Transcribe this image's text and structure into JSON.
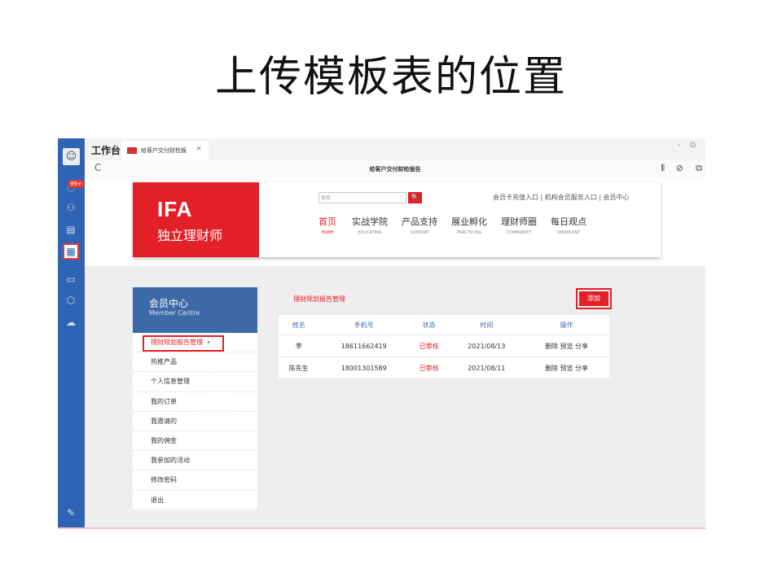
{
  "slide": {
    "title": "上传模板表的位置"
  },
  "app": {
    "name": "工作台"
  },
  "tab": {
    "title": "给客户交付财检报",
    "close": "×"
  },
  "window": {
    "minimize": "–",
    "restore": "⧉"
  },
  "navbar": {
    "reload": "C",
    "page_title": "给客户交付财检报告",
    "icons": [
      "⫴",
      "⊘",
      "⧉"
    ]
  },
  "dock": {
    "badge": "99+",
    "icons": [
      "chat-icon",
      "org-icon",
      "calendar-icon",
      "apps-icon",
      "mail-icon",
      "cube-icon",
      "cloud-icon",
      "edit-icon"
    ]
  },
  "header": {
    "logo_en": "IFA",
    "logo_cn": "独立理财师",
    "search_placeholder": "搜索",
    "search_icon": "🔍",
    "top_links": "会员卡充值入口 | 机构会员服务入口 | 会员中心",
    "menu": [
      {
        "cn": "首页",
        "en": "HOME"
      },
      {
        "cn": "实战学院",
        "en": "EDUCATING"
      },
      {
        "cn": "产品支持",
        "en": "SUPPORT"
      },
      {
        "cn": "展业孵化",
        "en": "PRACTICING"
      },
      {
        "cn": "理财师圈",
        "en": "COMMUNITY"
      },
      {
        "cn": "每日观点",
        "en": "VIEWPOINT"
      }
    ]
  },
  "member": {
    "title_cn": "会员中心",
    "title_en": "Member Centre",
    "items": [
      "理财规划报告管理",
      "热推产品",
      "个人信息管理",
      "我的订单",
      "我邀请的",
      "我的佣金",
      "我参加的活动",
      "修改密码",
      "退出"
    ],
    "active_arrow": "▸"
  },
  "main": {
    "section_title": "理财规划报告管理",
    "add_label": "添加",
    "columns": [
      "姓名",
      "手机号",
      "状态",
      "时间",
      "操作"
    ],
    "rows": [
      {
        "name": "李",
        "phone": "18611662419",
        "status": "已审核",
        "date": "2021/08/13",
        "actions": "删除 预览 分享"
      },
      {
        "name": "陈先生",
        "phone": "18001301589",
        "status": "已审核",
        "date": "2021/08/11",
        "actions": "删除 预览 分享"
      }
    ]
  }
}
